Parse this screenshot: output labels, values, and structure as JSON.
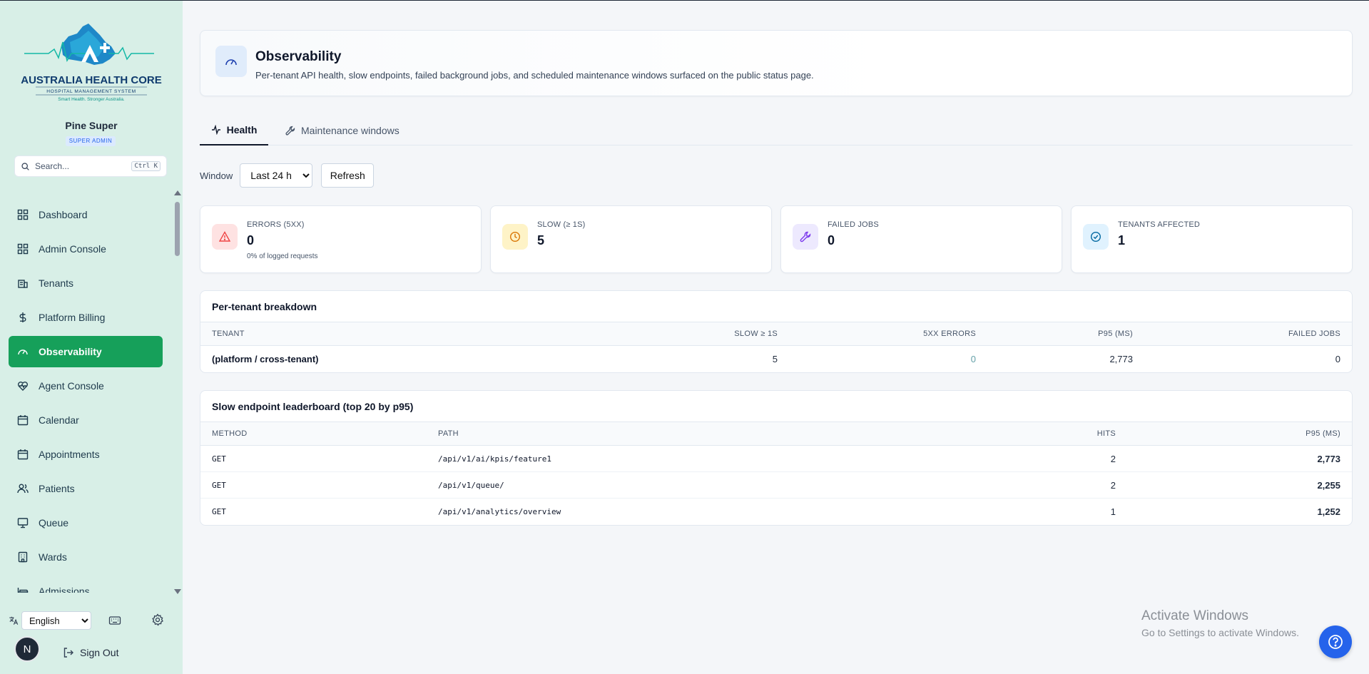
{
  "brand": {
    "name": "AUSTRALIA HEALTH CORE",
    "tagline": "HOSPITAL MANAGEMENT SYSTEM",
    "motto": "Smart Health. Stronger Australia."
  },
  "user": {
    "name": "Pine Super",
    "role": "SUPER ADMIN",
    "initial": "N"
  },
  "search": {
    "placeholder": "Search...",
    "shortcut": "Ctrl K"
  },
  "nav": [
    {
      "label": "Dashboard",
      "icon": "dashboard-icon"
    },
    {
      "label": "Admin Console",
      "icon": "grid-icon"
    },
    {
      "label": "Tenants",
      "icon": "building-icon"
    },
    {
      "label": "Platform Billing",
      "icon": "dollar-icon"
    },
    {
      "label": "Observability",
      "icon": "gauge-icon",
      "active": true
    },
    {
      "label": "Agent Console",
      "icon": "heart-pulse-icon"
    },
    {
      "label": "Calendar",
      "icon": "calendar-icon"
    },
    {
      "label": "Appointments",
      "icon": "calendar-check-icon"
    },
    {
      "label": "Patients",
      "icon": "users-icon"
    },
    {
      "label": "Queue",
      "icon": "monitor-icon"
    },
    {
      "label": "Wards",
      "icon": "ward-icon"
    },
    {
      "label": "Admissions",
      "icon": "bed-icon"
    }
  ],
  "footer": {
    "language": "English",
    "sign_out": "Sign Out"
  },
  "header": {
    "title": "Observability",
    "subtitle": "Per-tenant API health, slow endpoints, failed background jobs, and scheduled maintenance windows surfaced on the public status page."
  },
  "tabs": [
    {
      "label": "Health",
      "active": true
    },
    {
      "label": "Maintenance windows",
      "active": false
    }
  ],
  "controls": {
    "window_label": "Window",
    "window_value": "Last 24 h",
    "refresh_label": "Refresh"
  },
  "stats": [
    {
      "label": "ERRORS (5XX)",
      "value": "0",
      "sub": "0% of logged requests",
      "color": "#ef4444",
      "bg": "#fee2e2"
    },
    {
      "label": "SLOW (≥ 1S)",
      "value": "5",
      "sub": "",
      "color": "#d97706",
      "bg": "#fef3c7"
    },
    {
      "label": "FAILED JOBS",
      "value": "0",
      "sub": "",
      "color": "#7c3aed",
      "bg": "#ede9fe"
    },
    {
      "label": "TENANTS AFFECTED",
      "value": "1",
      "sub": "",
      "color": "#0369a1",
      "bg": "#e0f2fe"
    }
  ],
  "tenant_table": {
    "title": "Per-tenant breakdown",
    "headers": [
      "TENANT",
      "5XX ERRORS",
      "SLOW ≥ 1S",
      "P95 (MS)",
      "FAILED JOBS"
    ],
    "rows": [
      [
        "(platform / cross-tenant)",
        "0",
        "5",
        "2,773",
        "0"
      ]
    ]
  },
  "endpoint_table": {
    "title": "Slow endpoint leaderboard (top 20 by p95)",
    "headers": [
      "METHOD",
      "PATH",
      "HITS",
      "P95 (MS)"
    ],
    "rows": [
      [
        "GET",
        "/api/v1/ai/kpis/feature1",
        "2",
        "2,773"
      ],
      [
        "GET",
        "/api/v1/queue/",
        "2",
        "2,255"
      ],
      [
        "GET",
        "/api/v1/analytics/overview",
        "1",
        "1,252"
      ]
    ]
  },
  "watermark": {
    "line1": "Activate Windows",
    "line2": "Go to Settings to activate Windows."
  },
  "colors": {
    "accent": "#16a05a",
    "sidebar": "#d8efe7",
    "help": "#2563eb"
  }
}
